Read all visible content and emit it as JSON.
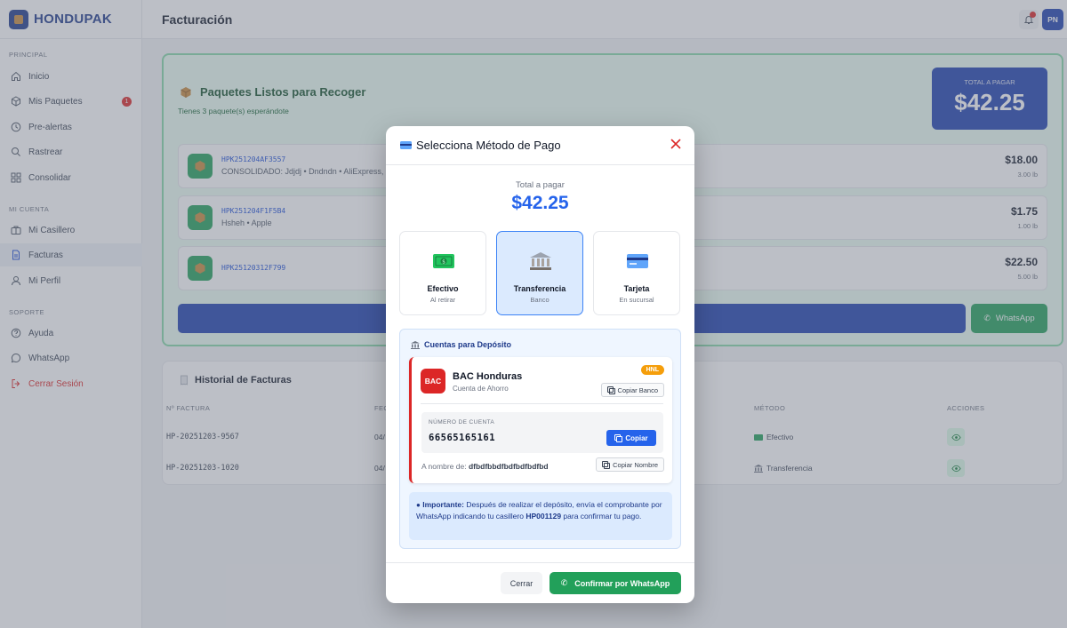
{
  "app": {
    "name": "HONDUPAK"
  },
  "sidebar": {
    "sections": {
      "principal": "PRINCIPAL",
      "cuenta": "MI CUENTA",
      "soporte": "SOPORTE"
    },
    "items": [
      {
        "label": "Inicio",
        "icon": "home-icon"
      },
      {
        "label": "Mis Paquetes",
        "icon": "box-icon",
        "badge": "1"
      },
      {
        "label": "Pre-alertas",
        "icon": "clock-icon"
      },
      {
        "label": "Rastrear",
        "icon": "search-icon"
      },
      {
        "label": "Consolidar",
        "icon": "grid-icon"
      },
      {
        "label": "Mi Casillero",
        "icon": "locker-icon"
      },
      {
        "label": "Facturas",
        "icon": "document-icon",
        "active": true
      },
      {
        "label": "Mi Perfil",
        "icon": "user-icon"
      },
      {
        "label": "Ayuda",
        "icon": "help-icon"
      },
      {
        "label": "WhatsApp",
        "icon": "chat-icon"
      },
      {
        "label": "Cerrar Sesión",
        "icon": "logout-icon"
      }
    ]
  },
  "header": {
    "title": "Facturación",
    "avatar": "PN"
  },
  "pickup": {
    "title": "Paquetes Listos para Recoger",
    "subtitle": "Tienes 3 paquete(s) esperándote",
    "total_label": "TOTAL A PAGAR",
    "total_value": "$42.25",
    "packages": [
      {
        "code": "HPK251204AF3557",
        "desc": "CONSOLIDADO: Jdjdj • Dndndn • AliExpress,",
        "amount": "$18.00",
        "weight": "3.00 lb"
      },
      {
        "code": "HPK251204F1F5B4",
        "desc": "Hsheh • Apple",
        "amount": "$1.75",
        "weight": "1.00 lb"
      },
      {
        "code": "HPK25120312F799",
        "desc": "",
        "amount": "$22.50",
        "weight": "5.00 lb"
      }
    ],
    "whatsapp_label": "WhatsApp"
  },
  "history": {
    "title": "Historial de Facturas",
    "columns": [
      "Nº FACTURA",
      "FEC",
      "MÉTODO",
      "ACCIONES"
    ],
    "rows": [
      {
        "invoice": "HP-20251203-9567",
        "date": "04/",
        "method": "Efectivo",
        "method_icon": "cash-icon"
      },
      {
        "invoice": "HP-20251203-1020",
        "date": "04/",
        "method": "Transferencia",
        "method_icon": "bank-icon"
      }
    ]
  },
  "modal": {
    "title": "Selecciona Método de Pago",
    "total_label": "Total a pagar",
    "total_value": "$42.25",
    "methods": [
      {
        "label": "Efectivo",
        "sub": "Al retirar",
        "icon": "cash-icon",
        "selected": false
      },
      {
        "label": "Transferencia",
        "sub": "Banco",
        "icon": "bank-icon",
        "selected": true
      },
      {
        "label": "Tarjeta",
        "sub": "En sucursal",
        "icon": "card-icon",
        "selected": false
      }
    ],
    "deposit": {
      "title": "Cuentas para Depósito",
      "bank_logo": "BAC",
      "bank_name": "BAC Honduras",
      "account_type": "Cuenta de Ahorro",
      "currency": "HNL",
      "copy_bank_label": "Copiar Banco",
      "account_label": "NÚMERO DE CUENTA",
      "account_number": "66565165161",
      "copy_label": "Copiar",
      "holder_label": "A nombre de:",
      "holder_name": "dfbdfbbdfbdfbdfbdfbd",
      "copy_name_label": "Copiar Nombre"
    },
    "note": {
      "bold": "Importante:",
      "text1": "Después de realizar el depósito, envía el comprobante por WhatsApp indicando tu casillero",
      "locker": "HP001129",
      "text2": "para confirmar tu pago."
    },
    "close_label": "Cerrar",
    "confirm_label": "Confirmar por WhatsApp"
  },
  "colors": {
    "primary": "#1e40af",
    "success": "#22a05a",
    "danger": "#dc2626",
    "accent": "#2563eb"
  }
}
